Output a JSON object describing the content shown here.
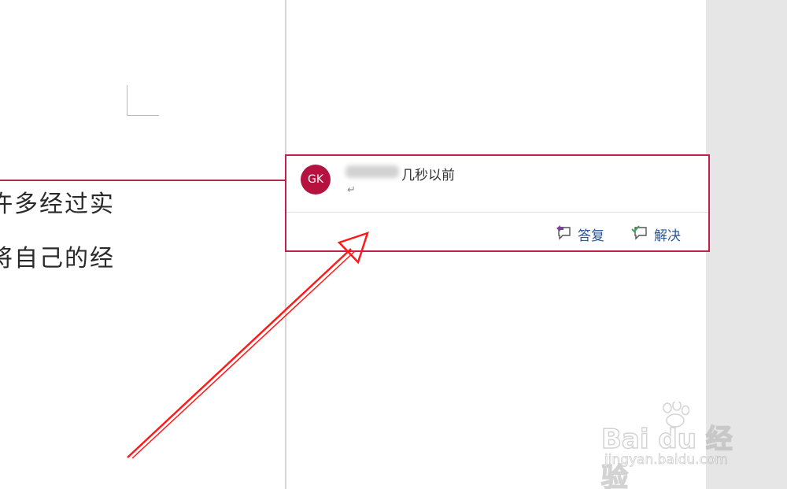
{
  "document": {
    "line1": "许多经过实",
    "line2": "将自己的经"
  },
  "comment": {
    "avatar_initials": "GK",
    "timestamp": "几秒以前",
    "body_mark": "↵",
    "actions": {
      "reply_label": "答复",
      "resolve_label": "解决"
    }
  },
  "watermark": {
    "logo_text": "Bai du 经验",
    "sub_text": "jingyan.baidu.com"
  },
  "colors": {
    "comment_border": "#c41e4a",
    "avatar_bg": "#b5123f",
    "action_text": "#2b5797",
    "annotation_arrow": "#ff1a1a"
  }
}
